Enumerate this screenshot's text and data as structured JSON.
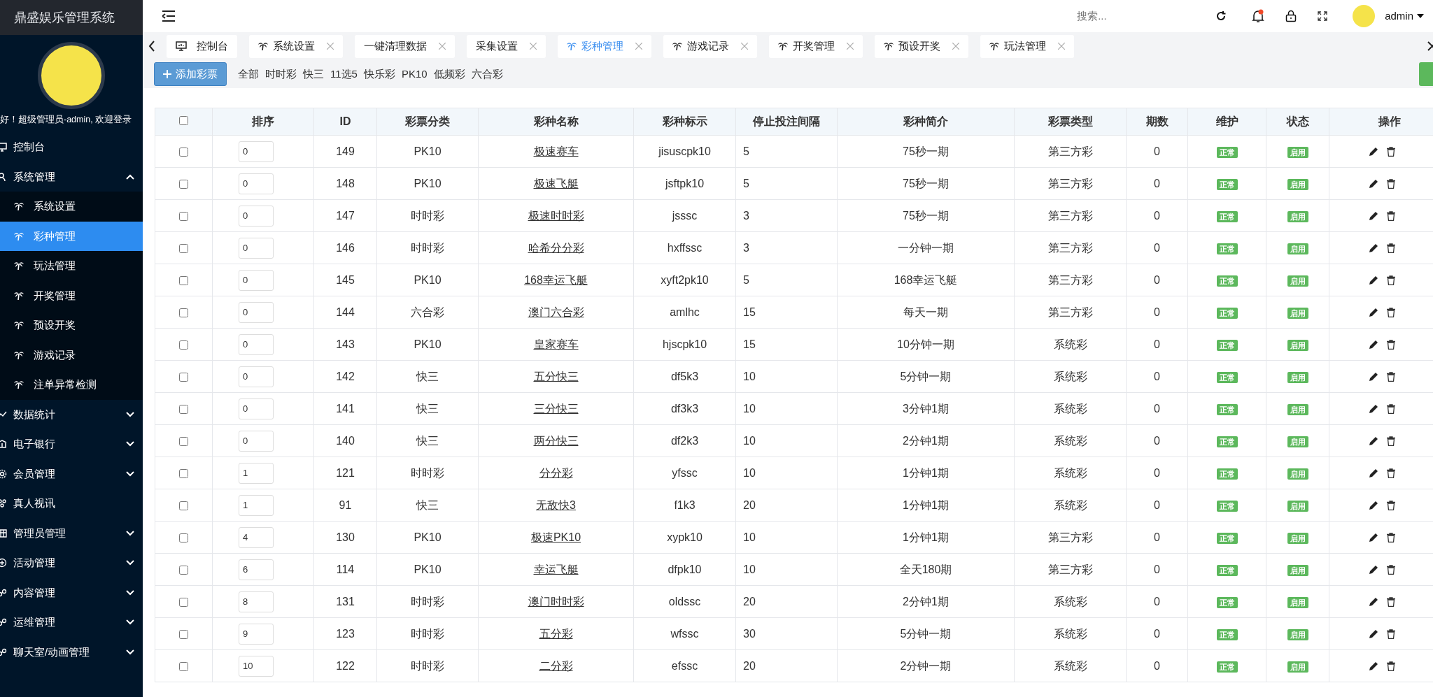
{
  "app_title": "鼎盛娱乐管理系统",
  "welcome": "好！超级管理员-admin, 欢迎登录",
  "sidebar": {
    "items": [
      {
        "label": "控制台",
        "kind": "link"
      },
      {
        "label": "系统管理",
        "kind": "group",
        "expanded": true,
        "children": [
          {
            "label": "系统设置",
            "selected": false
          },
          {
            "label": "彩种管理",
            "selected": true
          },
          {
            "label": "玩法管理",
            "selected": false
          },
          {
            "label": "开奖管理",
            "selected": false
          },
          {
            "label": "预设开奖",
            "selected": false
          },
          {
            "label": "游戏记录",
            "selected": false
          },
          {
            "label": "注单异常检测",
            "selected": false
          }
        ]
      },
      {
        "label": "数据统计",
        "kind": "group",
        "expanded": false
      },
      {
        "label": "电子银行",
        "kind": "group",
        "expanded": false
      },
      {
        "label": "会员管理",
        "kind": "group",
        "expanded": false
      },
      {
        "label": "真人视讯",
        "kind": "link"
      },
      {
        "label": "管理员管理",
        "kind": "group",
        "expanded": false
      },
      {
        "label": "活动管理",
        "kind": "group",
        "expanded": false
      },
      {
        "label": "内容管理",
        "kind": "group",
        "expanded": false
      },
      {
        "label": "运维管理",
        "kind": "group",
        "expanded": false
      },
      {
        "label": "聊天室/动画管理",
        "kind": "group",
        "expanded": false
      }
    ]
  },
  "topbar": {
    "search": {
      "placeholder": "搜索..."
    },
    "user": "admin"
  },
  "tabs": [
    {
      "label": "控制台",
      "closable": false,
      "selected": false
    },
    {
      "label": "系统设置",
      "closable": true,
      "selected": false
    },
    {
      "label": "一键清理数据",
      "closable": true,
      "selected": false
    },
    {
      "label": "采集设置",
      "closable": true,
      "selected": false
    },
    {
      "label": "彩种管理",
      "closable": true,
      "selected": true
    },
    {
      "label": "游戏记录",
      "closable": true,
      "selected": false
    },
    {
      "label": "开奖管理",
      "closable": true,
      "selected": false
    },
    {
      "label": "预设开奖",
      "closable": true,
      "selected": false
    },
    {
      "label": "玩法管理",
      "closable": true,
      "selected": false
    }
  ],
  "add_button": "添加彩票",
  "filters": [
    "全部",
    "时时彩",
    "快三",
    "11选5",
    "快乐彩",
    "PK10",
    "低频彩",
    "六合彩"
  ],
  "table": {
    "select_all": {
      "checked": false
    },
    "columns": [
      "排序",
      "ID",
      "彩票分类",
      "彩种名称",
      "彩种标示",
      "停止投注间隔",
      "彩种简介",
      "彩票类型",
      "期数",
      "维护",
      "状态",
      "操作"
    ],
    "rows": [
      {
        "checked": false,
        "sort": "0",
        "id": "149",
        "category": "PK10",
        "name": "极速赛车",
        "code": "jisuscpk10",
        "interval": "5",
        "intro": "75秒一期",
        "type": "第三方彩",
        "periods": "0",
        "maintenance": "正常",
        "status": "启用"
      },
      {
        "checked": false,
        "sort": "0",
        "id": "148",
        "category": "PK10",
        "name": "极速飞艇",
        "code": "jsftpk10",
        "interval": "5",
        "intro": "75秒一期",
        "type": "第三方彩",
        "periods": "0",
        "maintenance": "正常",
        "status": "启用"
      },
      {
        "checked": false,
        "sort": "0",
        "id": "147",
        "category": "时时彩",
        "name": "极速时时彩",
        "code": "jsssc",
        "interval": "3",
        "intro": "75秒一期",
        "type": "第三方彩",
        "periods": "0",
        "maintenance": "正常",
        "status": "启用"
      },
      {
        "checked": false,
        "sort": "0",
        "id": "146",
        "category": "时时彩",
        "name": "哈希分分彩",
        "code": "hxffssc",
        "interval": "3",
        "intro": "一分钟一期",
        "type": "第三方彩",
        "periods": "0",
        "maintenance": "正常",
        "status": "启用"
      },
      {
        "checked": false,
        "sort": "0",
        "id": "145",
        "category": "PK10",
        "name": "168幸运飞艇",
        "code": "xyft2pk10",
        "interval": "5",
        "intro": "168幸运飞艇",
        "type": "第三方彩",
        "periods": "0",
        "maintenance": "正常",
        "status": "启用"
      },
      {
        "checked": false,
        "sort": "0",
        "id": "144",
        "category": "六合彩",
        "name": "澳门六合彩",
        "code": "amlhc",
        "interval": "15",
        "intro": "每天一期",
        "type": "第三方彩",
        "periods": "0",
        "maintenance": "正常",
        "status": "启用"
      },
      {
        "checked": false,
        "sort": "0",
        "id": "143",
        "category": "PK10",
        "name": "皇家赛车",
        "code": "hjscpk10",
        "interval": "15",
        "intro": "10分钟一期",
        "type": "系统彩",
        "periods": "0",
        "maintenance": "正常",
        "status": "启用"
      },
      {
        "checked": false,
        "sort": "0",
        "id": "142",
        "category": "快三",
        "name": "五分快三",
        "code": "df5k3",
        "interval": "10",
        "intro": "5分钟一期",
        "type": "系统彩",
        "periods": "0",
        "maintenance": "正常",
        "status": "启用"
      },
      {
        "checked": false,
        "sort": "0",
        "id": "141",
        "category": "快三",
        "name": "三分快三",
        "code": "df3k3",
        "interval": "10",
        "intro": "3分钟1期",
        "type": "系统彩",
        "periods": "0",
        "maintenance": "正常",
        "status": "启用"
      },
      {
        "checked": false,
        "sort": "0",
        "id": "140",
        "category": "快三",
        "name": "两分快三",
        "code": "df2k3",
        "interval": "10",
        "intro": "2分钟1期",
        "type": "系统彩",
        "periods": "0",
        "maintenance": "正常",
        "status": "启用"
      },
      {
        "checked": false,
        "sort": "1",
        "id": "121",
        "category": "时时彩",
        "name": "分分彩",
        "code": "yfssc",
        "interval": "10",
        "intro": "1分钟1期",
        "type": "系统彩",
        "periods": "0",
        "maintenance": "正常",
        "status": "启用"
      },
      {
        "checked": false,
        "sort": "1",
        "id": "91",
        "category": "快三",
        "name": "无敌快3",
        "code": "f1k3",
        "interval": "20",
        "intro": "1分钟1期",
        "type": "系统彩",
        "periods": "0",
        "maintenance": "正常",
        "status": "启用"
      },
      {
        "checked": false,
        "sort": "4",
        "id": "130",
        "category": "PK10",
        "name": "极速PK10",
        "code": "xypk10",
        "interval": "10",
        "intro": "1分钟1期",
        "type": "第三方彩",
        "periods": "0",
        "maintenance": "正常",
        "status": "启用"
      },
      {
        "checked": false,
        "sort": "6",
        "id": "114",
        "category": "PK10",
        "name": "幸运飞艇",
        "code": "dfpk10",
        "interval": "10",
        "intro": "全天180期",
        "type": "第三方彩",
        "periods": "0",
        "maintenance": "正常",
        "status": "启用"
      },
      {
        "checked": false,
        "sort": "8",
        "id": "131",
        "category": "时时彩",
        "name": "澳门时时彩",
        "code": "oldssc",
        "interval": "20",
        "intro": "2分钟1期",
        "type": "系统彩",
        "periods": "0",
        "maintenance": "正常",
        "status": "启用"
      },
      {
        "checked": false,
        "sort": "9",
        "id": "123",
        "category": "时时彩",
        "name": "五分彩",
        "code": "wfssc",
        "interval": "30",
        "intro": "5分钟一期",
        "type": "系统彩",
        "periods": "0",
        "maintenance": "正常",
        "status": "启用"
      },
      {
        "checked": false,
        "sort": "10",
        "id": "122",
        "category": "时时彩",
        "name": "二分彩",
        "code": "efssc",
        "interval": "20",
        "intro": "2分钟一期",
        "type": "系统彩",
        "periods": "0",
        "maintenance": "正常",
        "status": "启用"
      }
    ]
  }
}
